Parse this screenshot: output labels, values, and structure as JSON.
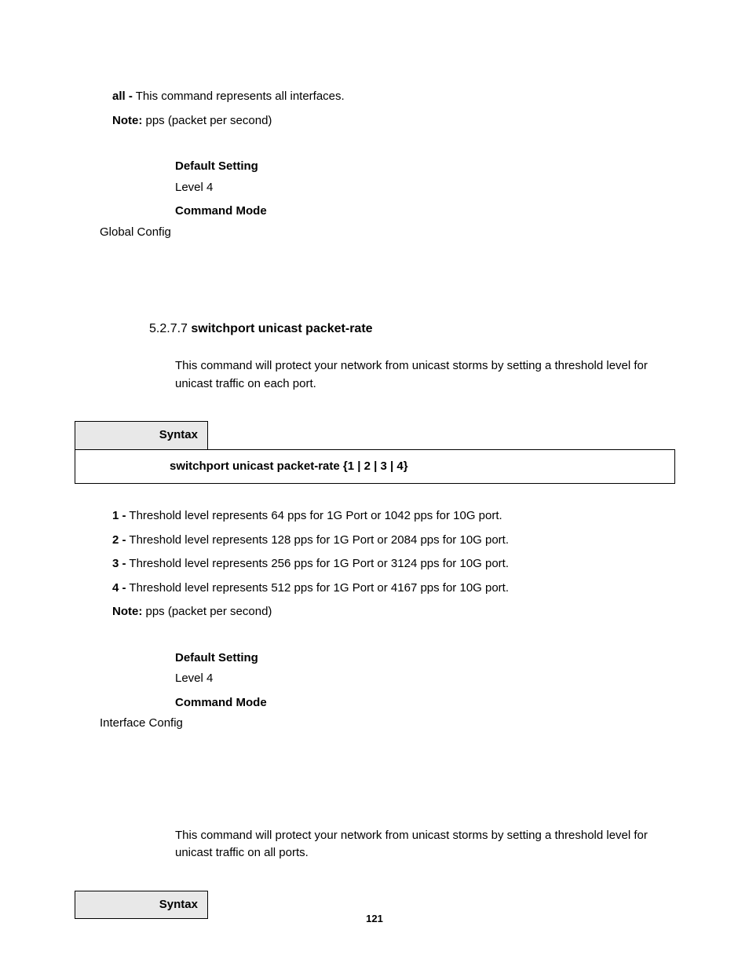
{
  "top": {
    "all_label": "all -",
    "all_text": " This command represents all interfaces.",
    "note_label": "Note:",
    "note_text": " pps (packet per second)",
    "default_setting_label": "Default Setting",
    "default_setting_value": "Level 4",
    "command_mode_label": "Command Mode",
    "command_mode_value": "Global Config"
  },
  "section": {
    "number": "5.2.7.7 ",
    "title": "switchport unicast packet-rate",
    "desc": "This command will protect your network from unicast storms by setting a threshold level for unicast traffic on each port.",
    "syntax_label": "Syntax",
    "syntax_command": "switchport unicast packet-rate {1 | 2 | 3 | 4}"
  },
  "thresholds": {
    "t1_label": "1 -",
    "t1_text": " Threshold level represents 64 pps for 1G Port or 1042 pps for 10G port.",
    "t2_label": "2 -",
    "t2_text": " Threshold level represents 128 pps for 1G Port or 2084 pps for 10G port.",
    "t3_label": "3 -",
    "t3_text": " Threshold level represents 256 pps for 1G Port or 3124 pps for 10G port.",
    "t4_label": "4 -",
    "t4_text": " Threshold level represents 512 pps for 1G Port or 4167 pps for 10G port.",
    "note_label": "Note:",
    "note_text": " pps (packet per second)"
  },
  "block2": {
    "default_setting_label": "Default Setting",
    "default_setting_value": "Level 4",
    "command_mode_label": "Command Mode",
    "command_mode_value": "Interface Config"
  },
  "bottom": {
    "desc": "This command will protect your network from unicast storms by setting a threshold level for unicast traffic on all ports.",
    "syntax_label": "Syntax"
  },
  "page_number": "121"
}
